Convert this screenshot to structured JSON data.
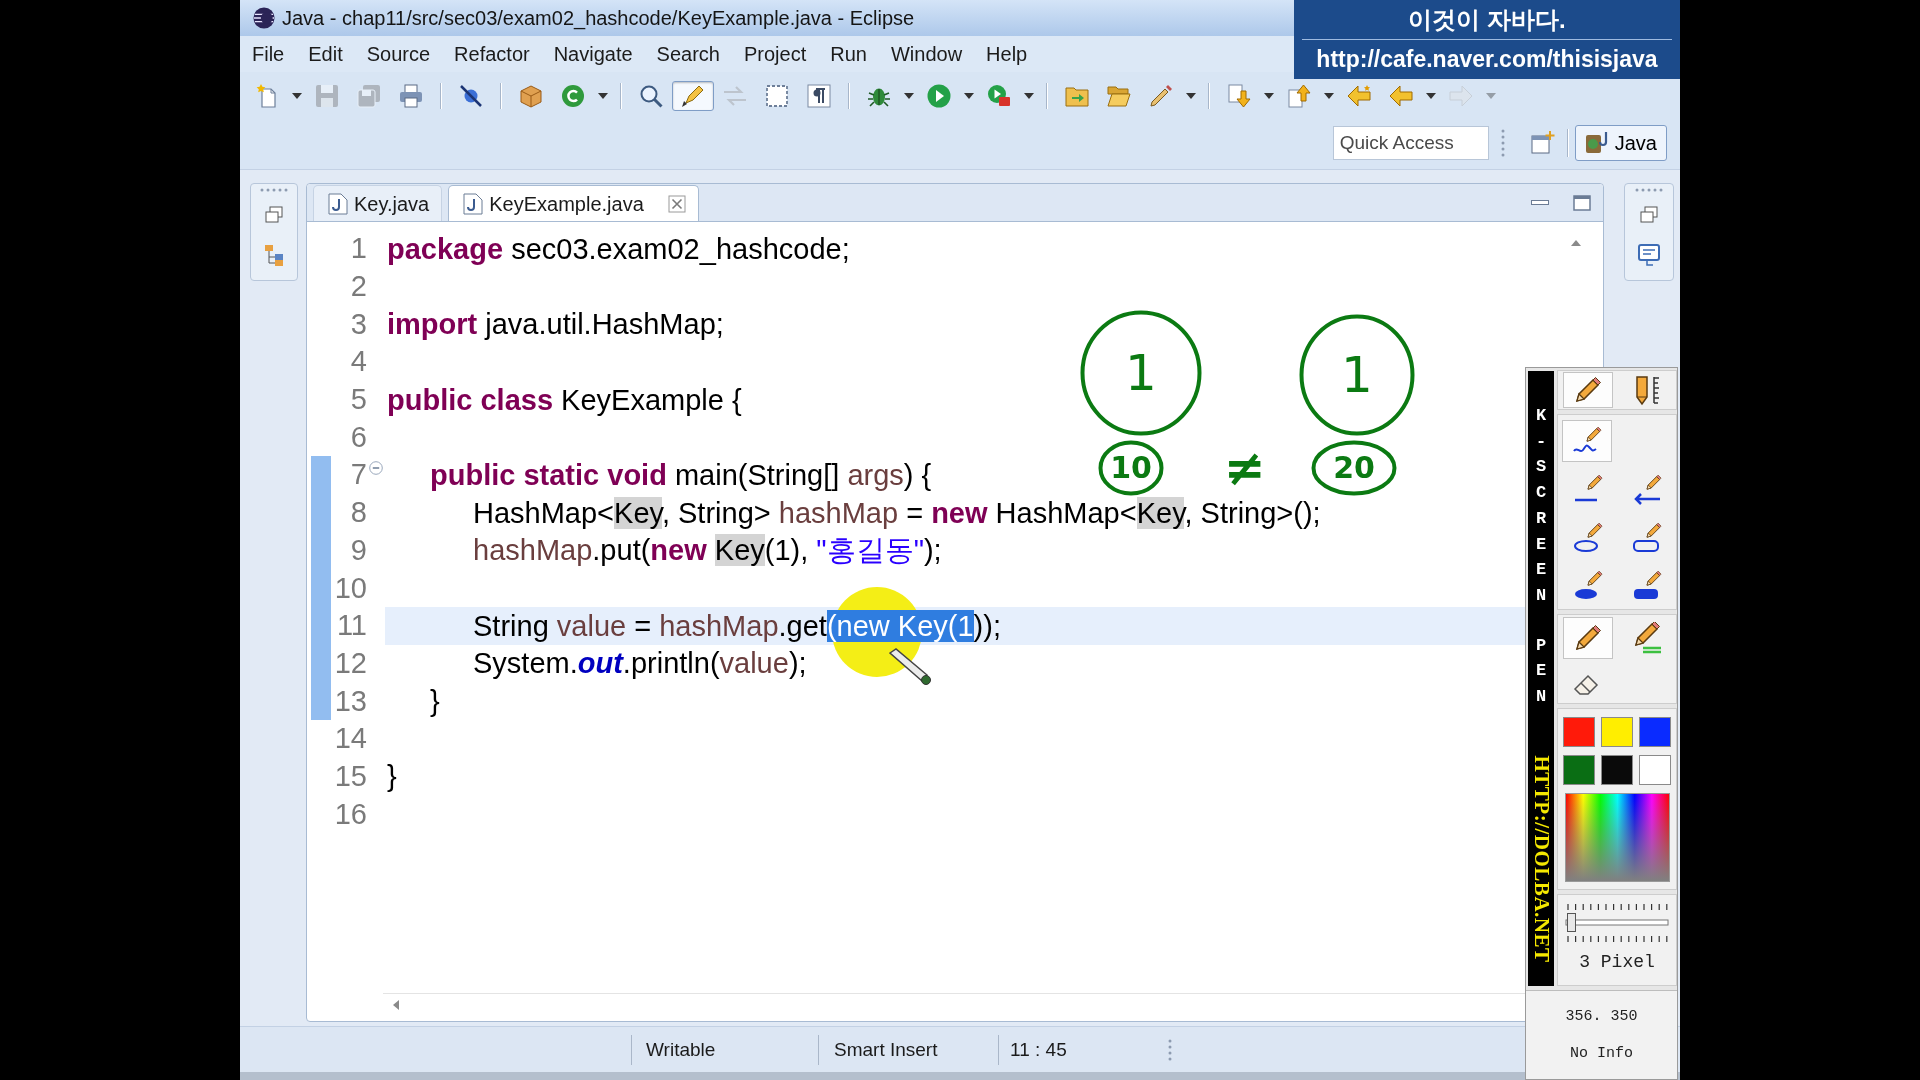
{
  "window": {
    "title": "Java - chap11/src/sec03/exam02_hashcode/KeyExample.java - Eclipse"
  },
  "banner": {
    "lines": [
      "이것이 자바다.",
      "http://cafe.naver.com/thisisjava"
    ]
  },
  "menu": [
    "File",
    "Edit",
    "Source",
    "Refactor",
    "Navigate",
    "Search",
    "Project",
    "Run",
    "Window",
    "Help"
  ],
  "toolbar": [
    [
      {
        "kind": "new",
        "disabled": false,
        "pressed": false,
        "dropdown": true
      },
      {
        "kind": "save",
        "disabled": true,
        "pressed": false,
        "dropdown": false
      },
      {
        "kind": "save-all",
        "disabled": true,
        "pressed": false,
        "dropdown": false
      },
      {
        "kind": "print",
        "disabled": false,
        "pressed": false,
        "dropdown": false
      }
    ],
    [
      {
        "kind": "skip-breakpoints",
        "disabled": false,
        "pressed": false,
        "dropdown": false
      }
    ],
    [
      {
        "kind": "new-package",
        "disabled": false,
        "pressed": false,
        "dropdown": false
      },
      {
        "kind": "new-class",
        "disabled": false,
        "pressed": false,
        "dropdown": true
      }
    ],
    [
      {
        "kind": "open-type",
        "disabled": false,
        "pressed": false,
        "dropdown": false
      },
      {
        "kind": "mark-occurrences",
        "disabled": false,
        "pressed": true,
        "dropdown": false
      },
      {
        "kind": "toggle-block",
        "disabled": true,
        "pressed": false,
        "dropdown": false
      },
      {
        "kind": "block-selection",
        "disabled": false,
        "pressed": false,
        "dropdown": false
      },
      {
        "kind": "show-whitespace",
        "disabled": false,
        "pressed": false,
        "dropdown": false
      }
    ],
    [
      {
        "kind": "debug",
        "disabled": false,
        "pressed": false,
        "dropdown": true
      },
      {
        "kind": "run",
        "disabled": false,
        "pressed": false,
        "dropdown": true
      },
      {
        "kind": "external-tools",
        "disabled": false,
        "pressed": false,
        "dropdown": true
      }
    ],
    [
      {
        "kind": "new-folder",
        "disabled": false,
        "pressed": false,
        "dropdown": false
      },
      {
        "kind": "open-folder",
        "disabled": false,
        "pressed": false,
        "dropdown": false
      },
      {
        "kind": "brush",
        "disabled": false,
        "pressed": false,
        "dropdown": true
      }
    ],
    [
      {
        "kind": "next-annotation",
        "disabled": false,
        "pressed": false,
        "dropdown": true
      },
      {
        "kind": "previous-annotation",
        "disabled": false,
        "pressed": false,
        "dropdown": true
      },
      {
        "kind": "last-edit",
        "disabled": false,
        "pressed": false,
        "dropdown": false
      },
      {
        "kind": "back",
        "disabled": false,
        "pressed": false,
        "dropdown": true
      },
      {
        "kind": "forward",
        "disabled": true,
        "pressed": false,
        "dropdown": true
      }
    ]
  ],
  "quick_access": {
    "placeholder": "Quick Access"
  },
  "perspectives": [
    {
      "label": "Java",
      "selected": true
    }
  ],
  "editor": {
    "tabs": [
      {
        "label": "Key.java",
        "selected": false
      },
      {
        "label": "KeyExample.java",
        "selected": true
      }
    ],
    "lines": [
      {
        "number": "1",
        "current": false,
        "in_range": false,
        "fold_marker": false,
        "tokens": [
          {
            "kind": "keyword",
            "text": "package"
          },
          {
            "kind": "plain",
            "text": " sec03.exam02_hashcode;"
          }
        ]
      },
      {
        "number": "2",
        "current": false,
        "in_range": false,
        "fold_marker": false
      },
      {
        "number": "3",
        "current": false,
        "in_range": false,
        "fold_marker": false,
        "tokens": [
          {
            "kind": "keyword",
            "text": "import"
          },
          {
            "kind": "plain",
            "text": " java.util.HashMap;"
          }
        ]
      },
      {
        "number": "4",
        "current": false,
        "in_range": false,
        "fold_marker": false
      },
      {
        "number": "5",
        "current": false,
        "in_range": false,
        "fold_marker": false,
        "tokens": [
          {
            "kind": "keyword",
            "text": "public class"
          },
          {
            "kind": "plain",
            "text": " KeyExample {"
          }
        ],
        "children": [
          {
            "number": "6",
            "current": false,
            "in_range": false,
            "fold_marker": false
          },
          {
            "number": "7",
            "current": false,
            "in_range": true,
            "fold_marker": true,
            "tokens": [
              {
                "kind": "keyword",
                "text": "public static void"
              },
              {
                "kind": "plain",
                "text": " main(String[] "
              },
              {
                "kind": "variable",
                "text": "args"
              },
              {
                "kind": "plain",
                "text": ") {"
              }
            ],
            "children": [
              {
                "number": "8",
                "current": false,
                "in_range": true,
                "fold_marker": false,
                "tokens": [
                  {
                    "kind": "plain",
                    "text": "HashMap<"
                  },
                  {
                    "kind": "occurrence",
                    "text": "Key"
                  },
                  {
                    "kind": "plain",
                    "text": ", String> "
                  },
                  {
                    "kind": "variable",
                    "text": "hashMap"
                  },
                  {
                    "kind": "plain",
                    "text": " = "
                  },
                  {
                    "kind": "keyword",
                    "text": "new"
                  },
                  {
                    "kind": "plain",
                    "text": " HashMap<"
                  },
                  {
                    "kind": "occurrence",
                    "text": "Key"
                  },
                  {
                    "kind": "plain",
                    "text": ", String>();"
                  }
                ]
              },
              {
                "number": "9",
                "current": false,
                "in_range": true,
                "fold_marker": false,
                "tokens": [
                  {
                    "kind": "variable",
                    "text": "hashMap"
                  },
                  {
                    "kind": "plain",
                    "text": ".put("
                  },
                  {
                    "kind": "keyword",
                    "text": "new "
                  },
                  {
                    "kind": "occurrence",
                    "text": "Key"
                  },
                  {
                    "kind": "plain",
                    "text": "(1), "
                  },
                  {
                    "kind": "string",
                    "text": "\"홍길동\""
                  },
                  {
                    "kind": "plain",
                    "text": ");"
                  }
                ]
              },
              {
                "number": "10",
                "current": false,
                "in_range": true,
                "fold_marker": false
              },
              {
                "number": "11",
                "current": true,
                "in_range": true,
                "fold_marker": false,
                "tokens": [
                  {
                    "kind": "plain",
                    "text": "String "
                  },
                  {
                    "kind": "variable",
                    "text": "value"
                  },
                  {
                    "kind": "plain",
                    "text": " = "
                  },
                  {
                    "kind": "variable",
                    "text": "hashMap"
                  },
                  {
                    "kind": "plain",
                    "text": ".get"
                  },
                  {
                    "kind": "selection",
                    "text": "(new Key(1"
                  },
                  {
                    "kind": "plain",
                    "text": "));"
                  }
                ]
              },
              {
                "number": "12",
                "current": false,
                "in_range": true,
                "fold_marker": false,
                "tokens": [
                  {
                    "kind": "plain",
                    "text": "System."
                  },
                  {
                    "kind": "field",
                    "text": "out"
                  },
                  {
                    "kind": "plain",
                    "text": ".println("
                  },
                  {
                    "kind": "variable",
                    "text": "value"
                  },
                  {
                    "kind": "plain",
                    "text": ");"
                  }
                ]
              }
            ]
          },
          {
            "number": "13",
            "current": false,
            "in_range": true,
            "fold_marker": false,
            "tokens": [
              {
                "kind": "plain",
                "text": "}"
              }
            ]
          },
          {
            "number": "14",
            "current": false,
            "in_range": false,
            "fold_marker": false
          }
        ]
      },
      {
        "number": "15",
        "current": false,
        "in_range": false,
        "fold_marker": false,
        "tokens": [
          {
            "kind": "plain",
            "text": "}"
          }
        ]
      },
      {
        "number": "16",
        "current": false,
        "in_range": false,
        "fold_marker": false
      }
    ]
  },
  "status_bar": [
    "Writable",
    "Smart Insert",
    "11 : 45"
  ],
  "annotations": [
    {
      "kind": "circle",
      "text": "1"
    },
    {
      "kind": "circle",
      "text": "1"
    },
    {
      "kind": "oval",
      "text": "10"
    },
    {
      "kind": "sign",
      "text": "≠"
    },
    {
      "kind": "oval",
      "text": "20"
    }
  ],
  "pen_panel": {
    "title": [
      "K-SCREEN",
      "PEN"
    ],
    "url": "HTTP://DOLBA.NET",
    "tool_groups": [
      [
        {
          "kind": "pencil",
          "selected": true
        },
        {
          "kind": "pencil-ruler",
          "selected": false
        }
      ],
      [
        {
          "kind": "freehand",
          "selected": true
        },
        {
          "kind": "line",
          "selected": false
        },
        {
          "kind": "arrow",
          "selected": false
        },
        {
          "kind": "ellipse",
          "selected": false
        },
        {
          "kind": "rectangle",
          "selected": false
        },
        {
          "kind": "filled-ellipse",
          "selected": false
        },
        {
          "kind": "filled-rectangle",
          "selected": false
        }
      ],
      [
        {
          "kind": "pencil",
          "selected": true
        },
        {
          "kind": "highlighter",
          "selected": false
        },
        {
          "kind": "eraser",
          "selected": false
        }
      ]
    ],
    "swatches": [
      {
        "color": "#ff1a0a"
      },
      {
        "color": "#ffee00"
      },
      {
        "color": "#0a2bff"
      },
      {
        "color": "#0a6e14"
      },
      {
        "color": "#0a0a0a"
      },
      {
        "color": "#ffffff"
      }
    ],
    "pen_width": {
      "level": 0.02,
      "reading": "3 Pixel"
    },
    "coordinates": "356. 350",
    "info": "No Info"
  }
}
